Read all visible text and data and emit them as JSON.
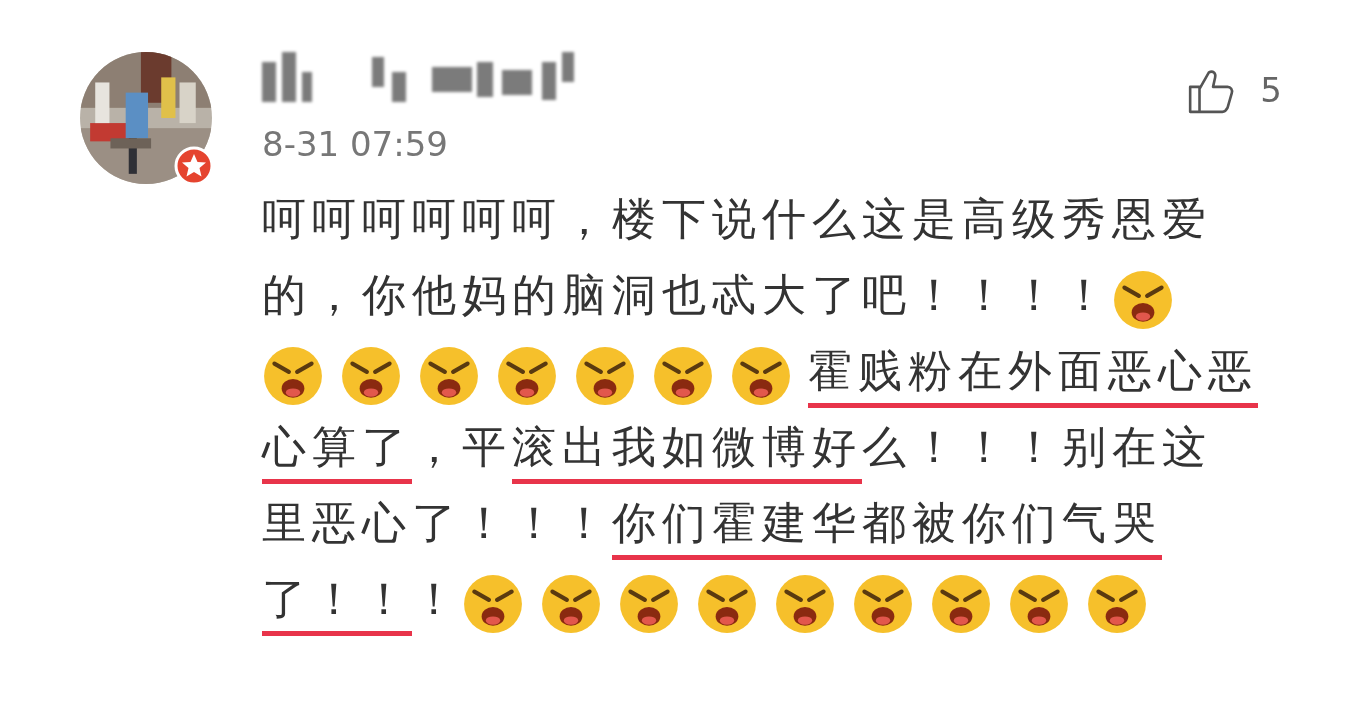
{
  "comment": {
    "name_blurred": true,
    "time": "8-31 07:59",
    "likes": "5",
    "lines": [
      [
        {
          "kind": "text",
          "text": "呵呵呵呵呵呵，楼下说什么这是高级秀恩爱",
          "underlined": false
        }
      ],
      [
        {
          "kind": "text",
          "text": "的，你他妈的脑洞也忒大了吧！！！！",
          "underlined": false
        },
        {
          "kind": "emoji"
        }
      ],
      [
        {
          "kind": "emoji"
        },
        {
          "kind": "emoji"
        },
        {
          "kind": "emoji"
        },
        {
          "kind": "emoji"
        },
        {
          "kind": "emoji"
        },
        {
          "kind": "emoji"
        },
        {
          "kind": "emoji"
        },
        {
          "kind": "text",
          "text": "霍贱粉在外面恶心恶",
          "underlined": true
        }
      ],
      [
        {
          "kind": "text",
          "text": "心算了",
          "underlined": true
        },
        {
          "kind": "text",
          "text": "，平",
          "underlined": false
        },
        {
          "kind": "text",
          "text": "滚出我如微博好",
          "underlined": true
        },
        {
          "kind": "text",
          "text": "么！！！别在这",
          "underlined": false
        }
      ],
      [
        {
          "kind": "text",
          "text": "里恶心了！！！",
          "underlined": false
        },
        {
          "kind": "text",
          "text": "你们霍建华都被你们气哭",
          "underlined": true
        }
      ],
      [
        {
          "kind": "text",
          "text": "了！！",
          "underlined": true
        },
        {
          "kind": "text",
          "text": "！",
          "underlined": false
        },
        {
          "kind": "emoji"
        },
        {
          "kind": "emoji"
        },
        {
          "kind": "emoji"
        },
        {
          "kind": "emoji"
        },
        {
          "kind": "emoji"
        },
        {
          "kind": "emoji"
        },
        {
          "kind": "emoji"
        },
        {
          "kind": "emoji"
        },
        {
          "kind": "emoji"
        }
      ]
    ]
  }
}
